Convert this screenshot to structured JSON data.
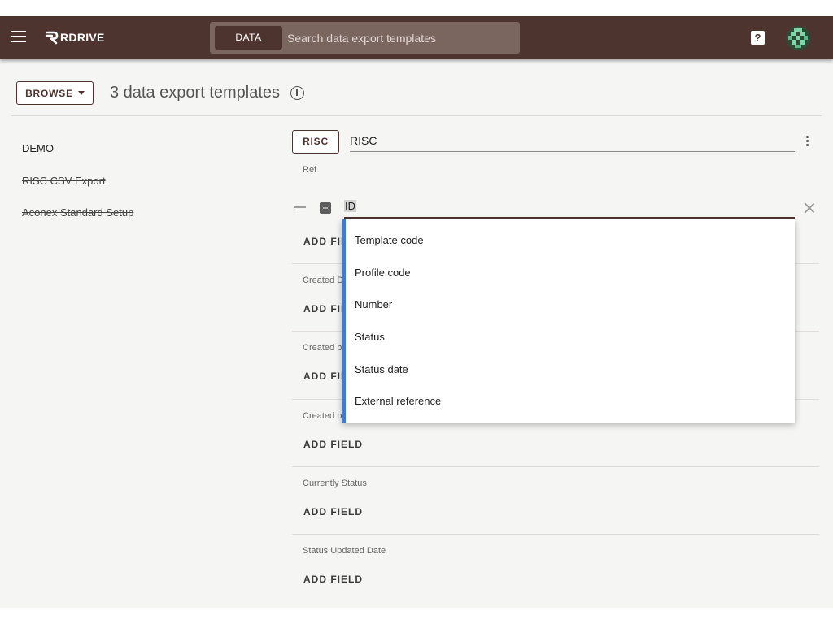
{
  "header": {
    "brand": "RDRIVE",
    "search_chip": "DATA",
    "search_placeholder": "Search data export templates",
    "help_symbol": "?"
  },
  "toolbar": {
    "browse_label": "BROWSE",
    "title": "3 data export templates"
  },
  "templates": [
    {
      "label": "DEMO",
      "struck": false
    },
    {
      "label": "RISC CSV Export",
      "struck": true
    },
    {
      "label": "Aconex Standard Setup",
      "struck": true
    }
  ],
  "editor": {
    "code_label": "RISC",
    "name_value": "RISC",
    "add_field_label": "ADD FIELD",
    "sections": [
      "Ref",
      "Created D",
      "Created b",
      "Created b",
      "Currently Status",
      "Status Updated Date"
    ],
    "field_input_value": "ID"
  },
  "dropdown": {
    "options": [
      "Template code",
      "Profile code",
      "Number",
      "Status",
      "Status date",
      "External reference"
    ]
  },
  "colors": {
    "topbar": "#4e342e",
    "accent": "#4a78c8",
    "background": "#f5f5f4"
  }
}
